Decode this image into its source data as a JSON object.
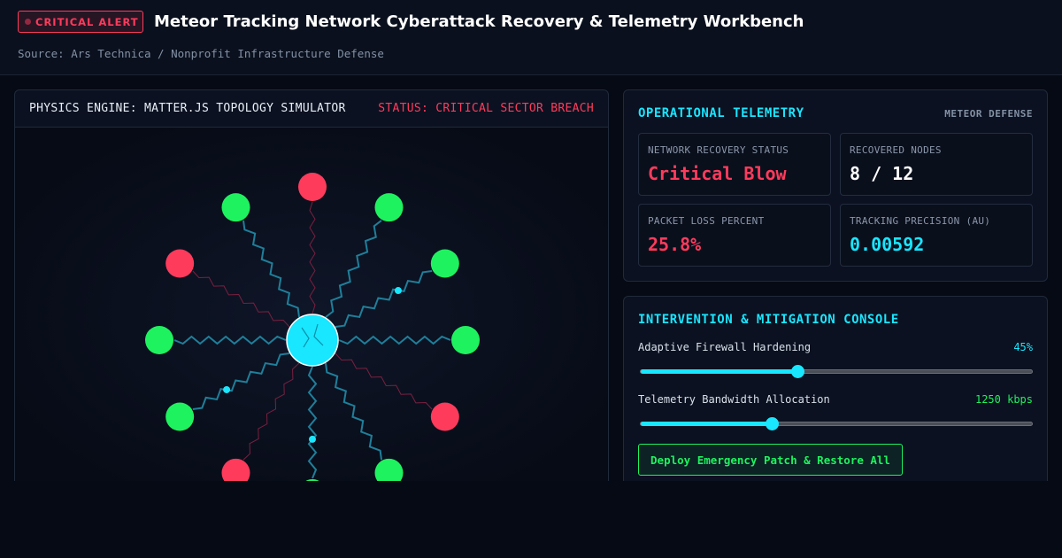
{
  "header": {
    "badge": "CRITICAL ALERT",
    "title": "Meteor Tracking Network Cyberattack Recovery & Telemetry Workbench",
    "source": "Source: Ars Technica / Nonprofit Infrastructure Defense"
  },
  "simulator": {
    "title": "PHYSICS ENGINE: MATTER.JS TOPOLOGY SIMULATOR",
    "status": "STATUS: CRITICAL SECTOR BREACH"
  },
  "telemetry": {
    "title": "OPERATIONAL TELEMETRY",
    "brand": "METEOR DEFENSE",
    "cards": [
      {
        "label": "NETWORK RECOVERY STATUS",
        "value": "Critical Blow",
        "color": "#ff3b5c"
      },
      {
        "label": "RECOVERED NODES",
        "value": "8 / 12",
        "color": "#ffffff"
      },
      {
        "label": "PACKET LOSS PERCENT",
        "value": "25.8%",
        "color": "#ff3b5c"
      },
      {
        "label": "TRACKING PRECISION (AU)",
        "value": "0.00592",
        "color": "#19e6ff"
      }
    ]
  },
  "console": {
    "title": "INTERVENTION & MITIGATION CONSOLE",
    "sliders": [
      {
        "name": "Adaptive Firewall Hardening",
        "value": "45%",
        "value_color": "#19e6ff",
        "level": 0.4
      },
      {
        "name": "Telemetry Bandwidth Allocation",
        "value": "1250 kbps",
        "value_color": "#1ff25f",
        "level": 0.335
      }
    ],
    "deploy_label": "Deploy Emergency Patch & Restore All"
  },
  "colors": {
    "accent": "#19e6ff",
    "ok": "#1ff25f",
    "critical": "#ff3b5c"
  },
  "topology": {
    "nodes": [
      {
        "status": "critical",
        "deg": -90
      },
      {
        "status": "ok",
        "deg": -60
      },
      {
        "status": "ok",
        "deg": -30
      },
      {
        "status": "ok",
        "deg": 0
      },
      {
        "status": "critical",
        "deg": 30
      },
      {
        "status": "ok",
        "deg": 60
      },
      {
        "status": "ok",
        "deg": 90
      },
      {
        "status": "critical",
        "deg": 120
      },
      {
        "status": "ok",
        "deg": 150
      },
      {
        "status": "ok",
        "deg": 180
      },
      {
        "status": "critical",
        "deg": 210
      },
      {
        "status": "ok",
        "deg": 240
      }
    ]
  }
}
